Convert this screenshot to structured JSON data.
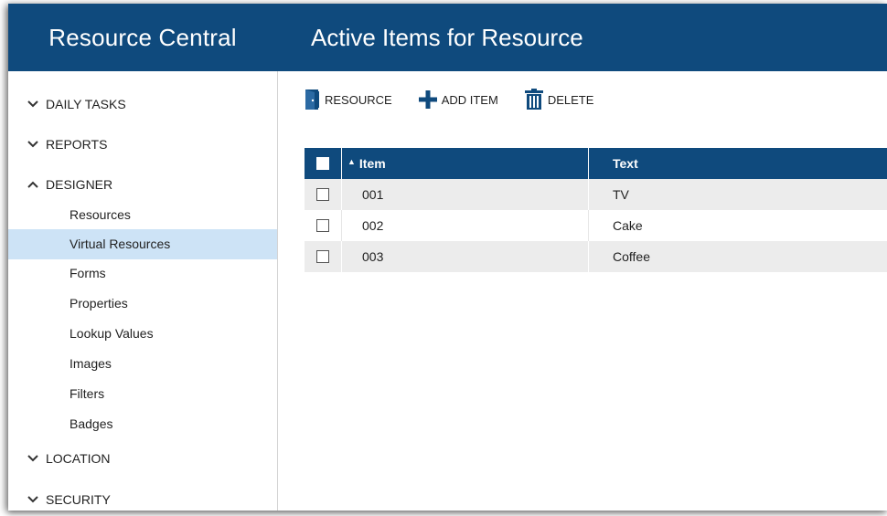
{
  "app": {
    "title": "Resource Central",
    "page_title": "Active Items for Resource"
  },
  "sidebar": {
    "sections": [
      {
        "label": "DAILY TASKS",
        "state": "collapsed",
        "icon": "chevron-down-icon"
      },
      {
        "label": "REPORTS",
        "state": "collapsed",
        "icon": "chevron-down-icon"
      },
      {
        "label": "DESIGNER",
        "state": "expanded",
        "icon": "chevron-up-icon"
      },
      {
        "label": "LOCATION",
        "state": "collapsed",
        "icon": "chevron-down-icon"
      },
      {
        "label": "SECURITY",
        "state": "collapsed",
        "icon": "chevron-down-icon"
      }
    ],
    "designer_items": [
      {
        "label": "Resources"
      },
      {
        "label": "Virtual Resources",
        "selected": true
      },
      {
        "label": "Forms"
      },
      {
        "label": "Properties"
      },
      {
        "label": "Lookup Values"
      },
      {
        "label": "Images"
      },
      {
        "label": "Filters"
      },
      {
        "label": "Badges"
      }
    ]
  },
  "toolbar": {
    "resource_label": "RESOURCE",
    "add_label": "ADD ITEM",
    "delete_label": "DELETE",
    "resource_icon": "door-icon",
    "add_icon": "plus-icon",
    "delete_icon": "trash-icon"
  },
  "grid": {
    "columns": [
      {
        "label": "Item",
        "sorted": "ascending"
      },
      {
        "label": "Text"
      }
    ],
    "rows": [
      {
        "item": "001",
        "text": "TV",
        "checked": false
      },
      {
        "item": "002",
        "text": "Cake",
        "checked": false
      },
      {
        "item": "003",
        "text": "Coffee",
        "checked": false
      }
    ]
  },
  "colors": {
    "header_bg": "#0f4a7d",
    "selected_bg": "#cde3f6",
    "alt_row_bg": "#ececec"
  }
}
